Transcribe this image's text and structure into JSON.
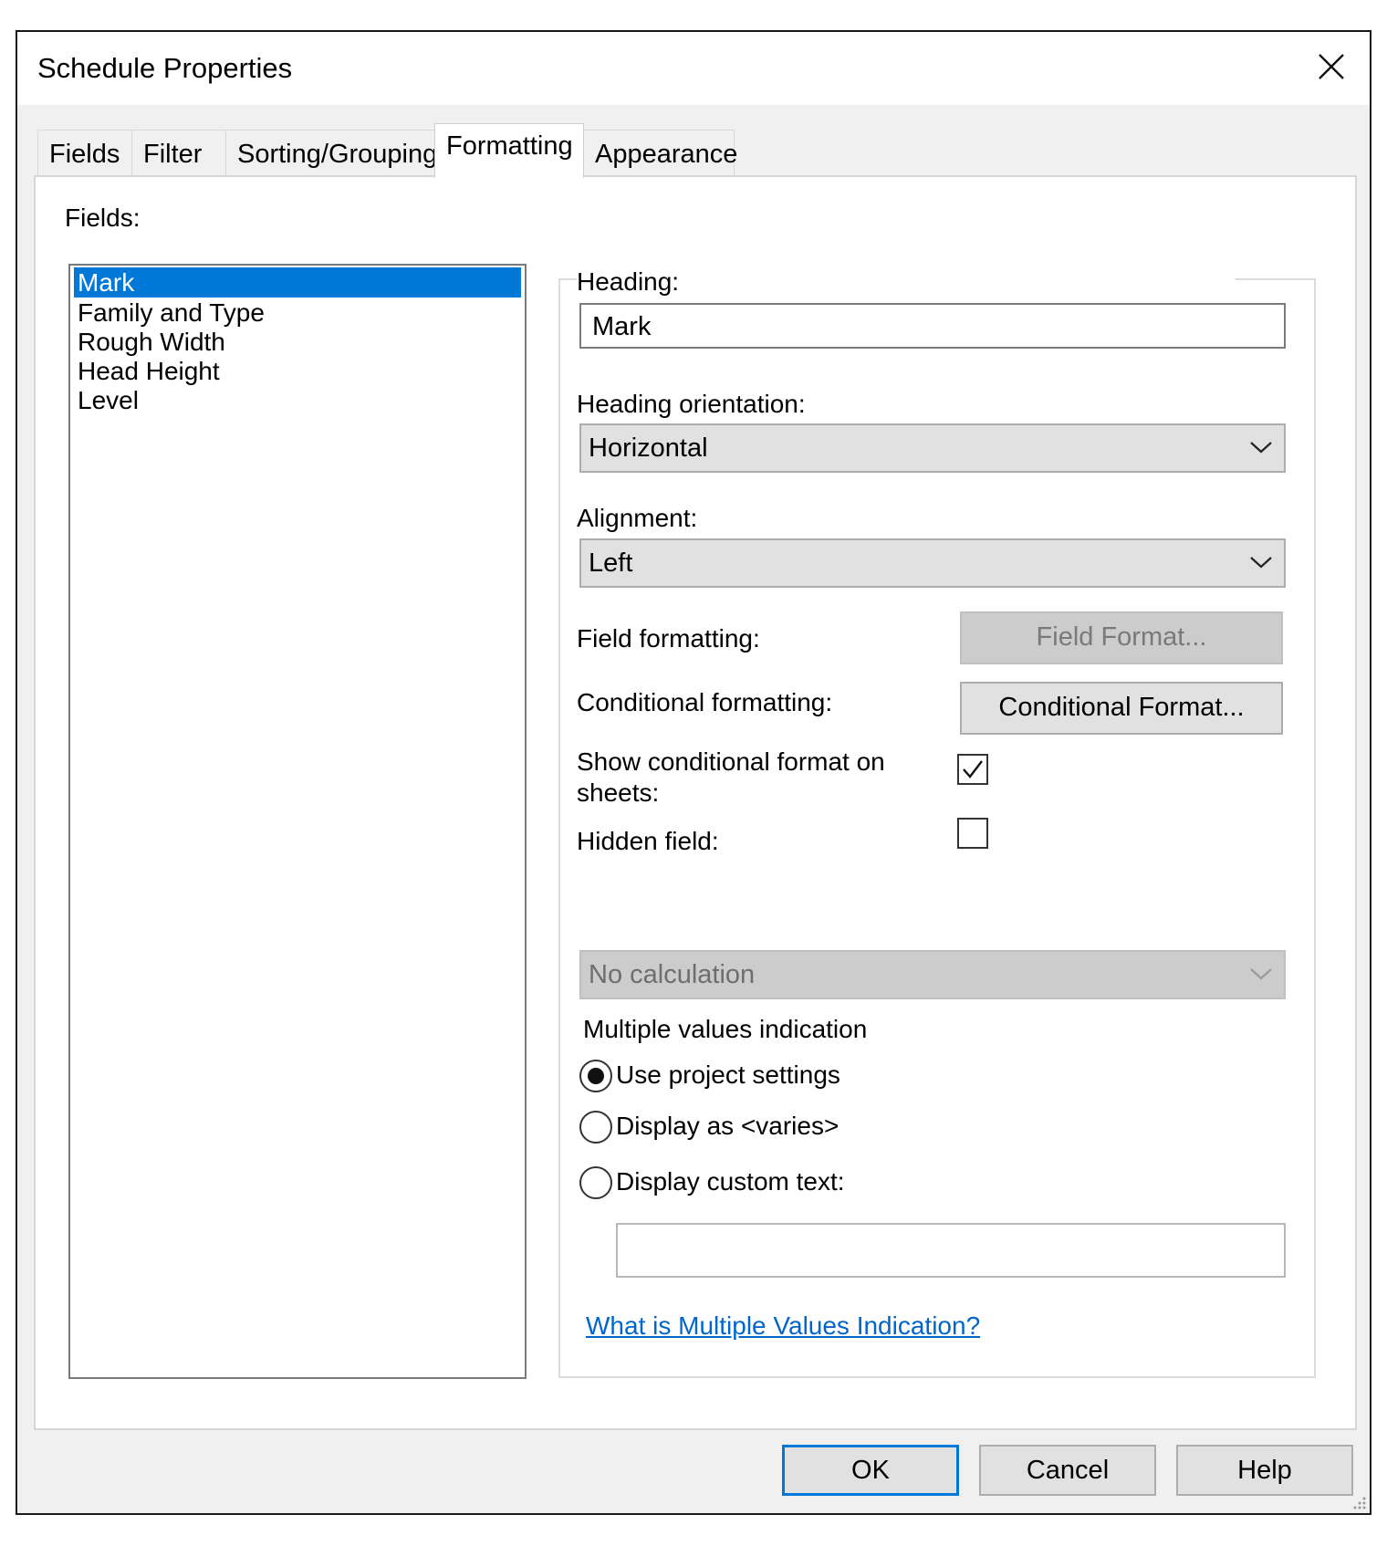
{
  "dialog": {
    "title": "Schedule Properties",
    "close_icon": "close-icon"
  },
  "tabs": [
    {
      "label": "Fields",
      "active": false
    },
    {
      "label": "Filter",
      "active": false
    },
    {
      "label": "Sorting/Grouping",
      "active": false
    },
    {
      "label": "Formatting",
      "active": true
    },
    {
      "label": "Appearance",
      "active": false
    }
  ],
  "fields_panel": {
    "label": "Fields:",
    "items": [
      "Mark",
      "Family and Type",
      "Rough Width",
      "Head Height",
      "Level"
    ],
    "selected": "Mark"
  },
  "formatting": {
    "heading_label": "Heading:",
    "heading_value": "Mark",
    "heading_orientation_label": "Heading orientation:",
    "heading_orientation_value": "Horizontal",
    "alignment_label": "Alignment:",
    "alignment_value": "Left",
    "field_formatting_label": "Field formatting:",
    "field_format_button": "Field Format...",
    "conditional_formatting_label": "Conditional formatting:",
    "conditional_format_button": "Conditional  Format...",
    "show_conditional_label_line1": "Show conditional format on",
    "show_conditional_label_line2": "sheets:",
    "show_conditional_checked": true,
    "hidden_field_label": "Hidden field:",
    "hidden_field_checked": false,
    "calculation_value": "No calculation",
    "multiple_values_label": "Multiple values indication",
    "radio_options": [
      {
        "label": "Use project settings",
        "checked": true
      },
      {
        "label": "Display as <varies>",
        "checked": false
      },
      {
        "label": "Display custom text:",
        "checked": false
      }
    ],
    "custom_text_value": "",
    "help_link": "What is Multiple Values Indication?"
  },
  "footer": {
    "ok": "OK",
    "cancel": "Cancel",
    "help": "Help"
  },
  "colors": {
    "selection": "#0078d7",
    "link": "#0066cc",
    "dialog_bg": "#f0f0f0"
  }
}
